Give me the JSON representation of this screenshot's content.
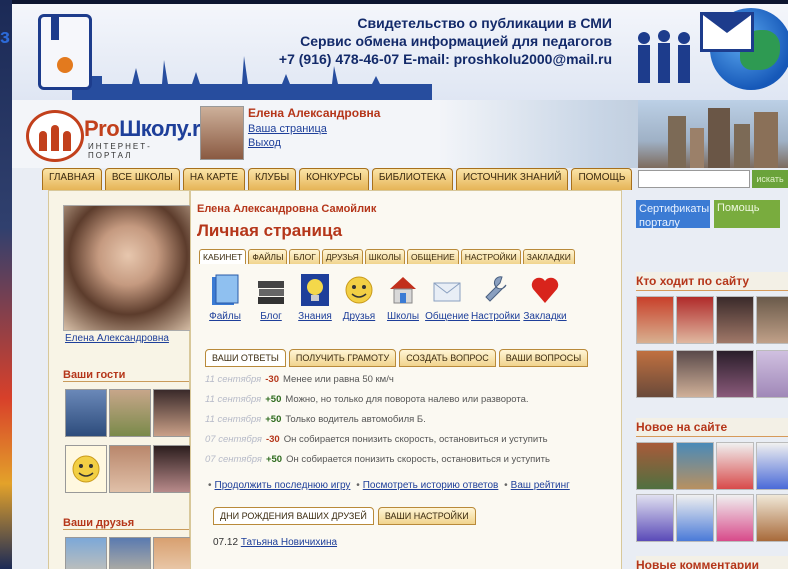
{
  "banner": {
    "line1": "Свидетельство о публикации в СМИ",
    "line2": "Сервис обмена информацией для педагогов",
    "line3": "+7 (916) 478-46-07 E-mail: proshkolu2000@mail.ru"
  },
  "logo": {
    "pro": "Pro",
    "name": "Школу.ru",
    "subtitle": "ИНТЕРНЕТ-ПОРТАЛ"
  },
  "user": {
    "name": "Елена Александровна",
    "my_page": "Ваша страница",
    "logout": "Выход"
  },
  "nav": [
    "ГЛАВНАЯ",
    "ВСЕ ШКОЛЫ",
    "НА КАРТЕ",
    "КЛУБЫ",
    "КОНКУРСЫ",
    "БИБЛИОТЕКА",
    "ИСТОЧНИК ЗНАНИЙ",
    "ПОМОЩЬ"
  ],
  "search": {
    "button": "искать"
  },
  "left": {
    "profile_name": "Елена Александровна",
    "guests_title": "Ваши гости",
    "friends_title": "Ваши друзья"
  },
  "main": {
    "owner": "Елена Александровна Самойлик",
    "title": "Личная страница",
    "tabs": [
      "КАБИНЕТ",
      "ФАЙЛЫ",
      "БЛОГ",
      "ДРУЗЬЯ",
      "ШКОЛЫ",
      "ОБЩЕНИЕ",
      "НАСТРОЙКИ",
      "ЗАКЛАДКИ"
    ],
    "icons": [
      {
        "label": "Файлы",
        "icon": "files-icon"
      },
      {
        "label": "Блог",
        "icon": "books-icon"
      },
      {
        "label": "Знания",
        "icon": "lightbulb-icon"
      },
      {
        "label": "Друзья",
        "icon": "smiley-icon"
      },
      {
        "label": "Школы",
        "icon": "house-icon"
      },
      {
        "label": "Общение",
        "icon": "envelope-icon"
      },
      {
        "label": "Настройки",
        "icon": "wrench-icon"
      },
      {
        "label": "Закладки",
        "icon": "heart-icon"
      }
    ],
    "qa_tabs": [
      "ВАШИ ОТВЕТЫ",
      "ПОЛУЧИТЬ ГРАМОТУ",
      "СОЗДАТЬ ВОПРОС",
      "ВАШИ ВОПРОСЫ"
    ],
    "answers": [
      {
        "date": "11 сентября",
        "points": "-30",
        "text": "Менее или равна 50 км/ч"
      },
      {
        "date": "11 сентября",
        "points": "+50",
        "text": "Можно, но только для поворота налево или разворота."
      },
      {
        "date": "11 сентября",
        "points": "+50",
        "text": "Только водитель автомобиля Б."
      },
      {
        "date": "07 сентября",
        "points": "-30",
        "text": "Он собирается понизить скорость, остановиться и уступить"
      },
      {
        "date": "07 сентября",
        "points": "+50",
        "text": "Он собирается понизить скорость, остановиться и уступить"
      }
    ],
    "links": [
      "Продолжить последнюю игру",
      "Посмотреть историю ответов",
      "Ваш рейтинг"
    ],
    "bday_tabs": [
      "ДНИ РОЖДЕНИЯ ВАШИХ ДРУЗЕЙ",
      "ВАШИ НАСТРОЙКИ"
    ],
    "bday": {
      "date": "07.12",
      "name": "Татьяна Новичихина"
    }
  },
  "right": {
    "cert_button": "Сертификаты порталу",
    "help_button": "Помощь",
    "visitors_title": "Кто ходит по сайту",
    "new_title": "Новое на сайте",
    "comments_title": "Новые комментарии"
  }
}
